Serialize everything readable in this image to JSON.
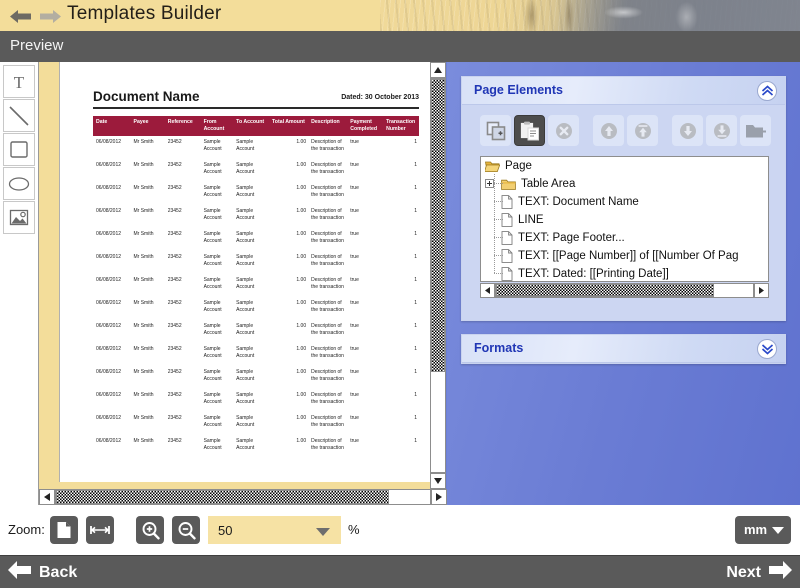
{
  "titlebar": {
    "app_title": "Templates Builder",
    "back_arrow_icon": "arrow-left-icon",
    "forward_arrow_icon": "arrow-right-icon"
  },
  "preview_bar": {
    "label": "Preview"
  },
  "tool_palette": {
    "tools": [
      {
        "name": "text-tool",
        "icon": "text-T-icon",
        "label": "T"
      },
      {
        "name": "line-tool",
        "icon": "diagonal-line-icon",
        "label": "Line"
      },
      {
        "name": "rectangle-tool",
        "icon": "rectangle-icon",
        "label": "Rectangle"
      },
      {
        "name": "ellipse-tool",
        "icon": "ellipse-icon",
        "label": "Ellipse"
      },
      {
        "name": "image-tool",
        "icon": "picture-icon",
        "label": "Image"
      }
    ]
  },
  "document": {
    "title": "Document Name",
    "dated": "Dated: 30 October 2013",
    "header_color": "#9c1b3c",
    "columns": [
      "Date",
      "Payee",
      "Reference",
      "From Account",
      "To Account",
      "Total Amount",
      "Description",
      "Payment Completed",
      "Transaction Number"
    ],
    "row_template": {
      "date": "06/08/2012",
      "payee": "Mr Smith",
      "reference": "23452",
      "from_account": "Sample Account",
      "to_account": "Sample Account",
      "total_amount": "1.00",
      "description": "Description of the transaction",
      "payment_completed": "true",
      "transaction_number": "1"
    },
    "row_count": 14
  },
  "page_elements_panel": {
    "title": "Page Elements",
    "collapse_icon": "chevron-double-up-icon",
    "toolbar_buttons": [
      {
        "name": "add-element-button",
        "icon": "copy-add-icon",
        "selected": false
      },
      {
        "name": "paste-element-button",
        "icon": "clipboard-paste-icon",
        "selected": true
      },
      {
        "name": "delete-element-button",
        "icon": "delete-x-icon",
        "selected": false
      },
      {
        "name": "move-up-button",
        "icon": "arrow-up-circle-icon",
        "selected": false
      },
      {
        "name": "move-to-top-button",
        "icon": "arrow-up-top-circle-icon",
        "selected": false
      },
      {
        "name": "move-down-button",
        "icon": "arrow-down-circle-icon",
        "selected": false
      },
      {
        "name": "move-to-bottom-button",
        "icon": "arrow-down-bottom-circle-icon",
        "selected": false
      },
      {
        "name": "group-element-button",
        "icon": "folder-in-icon",
        "selected": false
      }
    ],
    "tree": [
      {
        "label": "Page",
        "icon": "folder-open-icon",
        "depth": 0,
        "expandable": false
      },
      {
        "label": "Table Area",
        "icon": "folder-icon",
        "depth": 1,
        "expandable": true
      },
      {
        "label": "TEXT: Document Name",
        "icon": "page-icon",
        "depth": 1,
        "expandable": false
      },
      {
        "label": "LINE",
        "icon": "page-icon",
        "depth": 1,
        "expandable": false
      },
      {
        "label": "TEXT: Page Footer...",
        "icon": "page-icon",
        "depth": 1,
        "expandable": false
      },
      {
        "label": "TEXT: [[Page Number]] of [[Number Of Pag",
        "icon": "page-icon",
        "depth": 1,
        "expandable": false
      },
      {
        "label": "TEXT: Dated: [[Printing Date]]",
        "icon": "page-icon",
        "depth": 1,
        "expandable": false
      }
    ]
  },
  "formats_panel": {
    "title": "Formats",
    "expand_icon": "chevron-double-down-icon"
  },
  "zoom_bar": {
    "label": "Zoom:",
    "fit_page_icon": "page-fit-icon",
    "fit_width_icon": "width-fit-icon",
    "zoom_in_icon": "magnifier-plus-icon",
    "zoom_out_icon": "magnifier-minus-icon",
    "zoom_value": "50",
    "percent_symbol": "%",
    "unit_value": "mm",
    "combo_color": "#f6e2a4"
  },
  "bottom_nav": {
    "back_label": "Back",
    "next_label": "Next",
    "back_icon": "arrow-left-icon",
    "next_icon": "arrow-right-icon"
  }
}
